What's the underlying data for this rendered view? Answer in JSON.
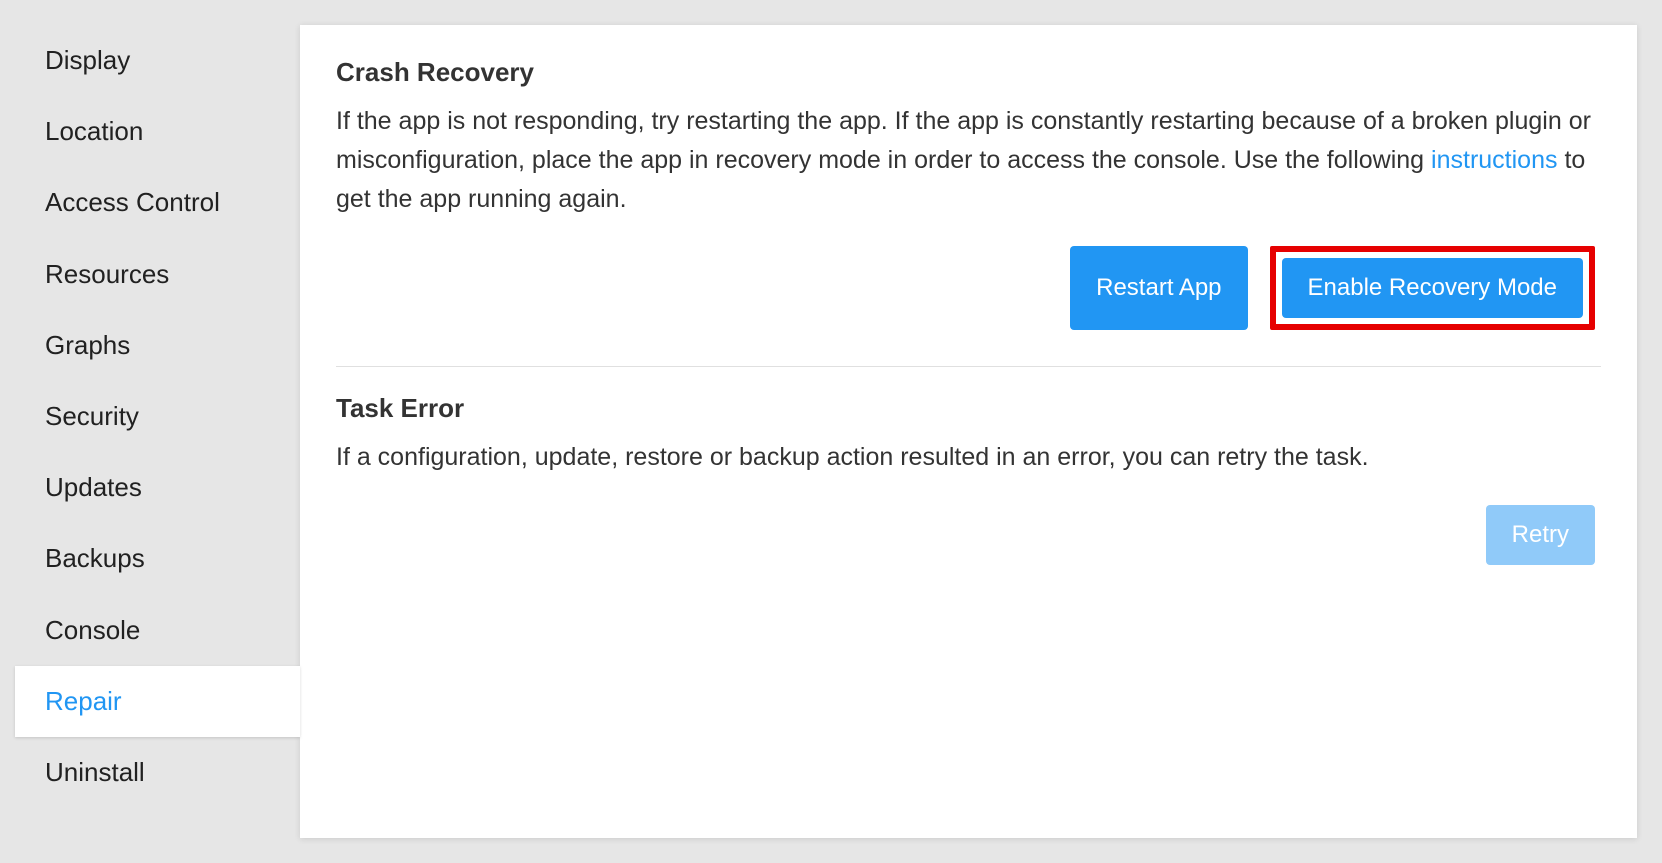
{
  "sidebar": {
    "items": [
      {
        "label": "Display",
        "active": false
      },
      {
        "label": "Location",
        "active": false
      },
      {
        "label": "Access Control",
        "active": false
      },
      {
        "label": "Resources",
        "active": false
      },
      {
        "label": "Graphs",
        "active": false
      },
      {
        "label": "Security",
        "active": false
      },
      {
        "label": "Updates",
        "active": false
      },
      {
        "label": "Backups",
        "active": false
      },
      {
        "label": "Console",
        "active": false
      },
      {
        "label": "Repair",
        "active": true
      },
      {
        "label": "Uninstall",
        "active": false
      }
    ]
  },
  "crash": {
    "title": "Crash Recovery",
    "text_before": "If the app is not responding, try restarting the app. If the app is constantly restarting because of a broken plugin or misconfiguration, place the app in recovery mode in order to access the console. Use the following ",
    "link_text": "instructions",
    "text_after": " to get the app running again.",
    "restart_label": "Restart App",
    "recovery_label": "Enable Recovery Mode"
  },
  "task": {
    "title": "Task Error",
    "text": "If a configuration, update, restore or backup action resulted in an error, you can retry the task.",
    "retry_label": "Retry"
  }
}
